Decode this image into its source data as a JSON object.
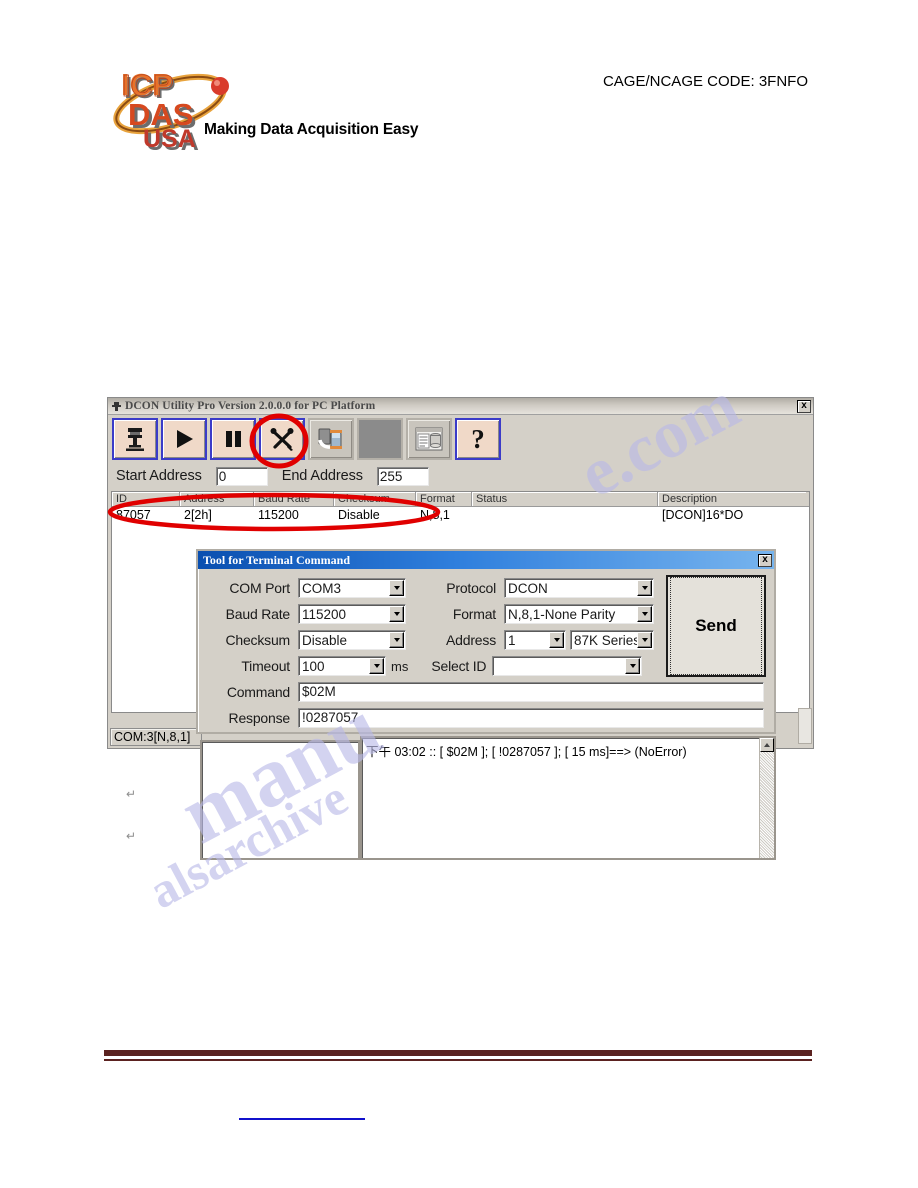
{
  "header": {
    "logo_alt": "ICP DAS USA",
    "logo_lines": [
      "ICP",
      "DAS",
      "USA"
    ],
    "tagline": "Making Data Acquisition Easy",
    "cage_code": "CAGE/NCAGE CODE: 3FNFO"
  },
  "app": {
    "title": "DCON Utility Pro Version 2.0.0.0 for PC Platform",
    "close_label": "x",
    "toolbar": [
      {
        "name": "com-port-button",
        "icon": "com-port-icon",
        "state": "enabled"
      },
      {
        "name": "start-scan-button",
        "icon": "play-icon",
        "state": "enabled"
      },
      {
        "name": "pause-scan-button",
        "icon": "pause-icon",
        "state": "enabled"
      },
      {
        "name": "terminal-tool-button",
        "icon": "tools-icon",
        "state": "enabled"
      },
      {
        "name": "module-transfer-button",
        "icon": "module-icon",
        "state": "disabled"
      },
      {
        "name": "spare-button",
        "icon": "blank-icon",
        "state": "disabled"
      },
      {
        "name": "report-button",
        "icon": "report-icon",
        "state": "disabled"
      },
      {
        "name": "help-button",
        "icon": "question-mark-icon",
        "state": "enabled",
        "glyph": "?"
      }
    ],
    "start_address_label": "Start Address",
    "start_address_value": "0",
    "end_address_label": "End Address",
    "end_address_value": "255",
    "grid": {
      "columns": [
        "ID",
        "Address",
        "Baud Rate",
        "Checksum",
        "Format",
        "Status",
        "Description"
      ],
      "rows": [
        {
          "id": "87057",
          "address": "2[2h]",
          "baud_rate": "115200",
          "checksum": "Disable",
          "format": "N,8,1",
          "status": "",
          "description": "[DCON]16*DO"
        }
      ]
    },
    "statusbar": "COM:3[N,8,1]"
  },
  "dialog": {
    "title": "Tool for Terminal Command",
    "close_label": "x",
    "fields": {
      "com_port_label": "COM Port",
      "com_port_value": "COM3",
      "baud_rate_label": "Baud Rate",
      "baud_rate_value": "115200",
      "checksum_label": "Checksum",
      "checksum_value": "Disable",
      "timeout_label": "Timeout",
      "timeout_value": "100",
      "timeout_unit": "ms",
      "protocol_label": "Protocol",
      "protocol_value": "DCON",
      "format_label": "Format",
      "format_value": "N,8,1-None Parity",
      "address_label": "Address",
      "address_value": "1",
      "series_value": "87K Series",
      "select_id_label": "Select ID",
      "select_id_value": "",
      "command_label": "Command",
      "command_value": "$02M",
      "response_label": "Response",
      "response_value": "!0287057"
    },
    "send_label": "Send"
  },
  "log": {
    "lines": [
      "下午 03:02 :: [ $02M ]; [ !0287057 ]; [ 15 ms]==> (NoError)"
    ]
  },
  "watermark": {
    "part1": "e.com",
    "part2": "manu",
    "part3": "alsarchive"
  },
  "marks": {
    "pilcrow": "↵"
  },
  "colors": {
    "annotation_red": "#e00000",
    "footer_rule": "#5b2220",
    "title_blue": "#2f7fdd",
    "toolbar_enabled_border": "#3b3bc8",
    "link_blue": "#1111cc"
  }
}
